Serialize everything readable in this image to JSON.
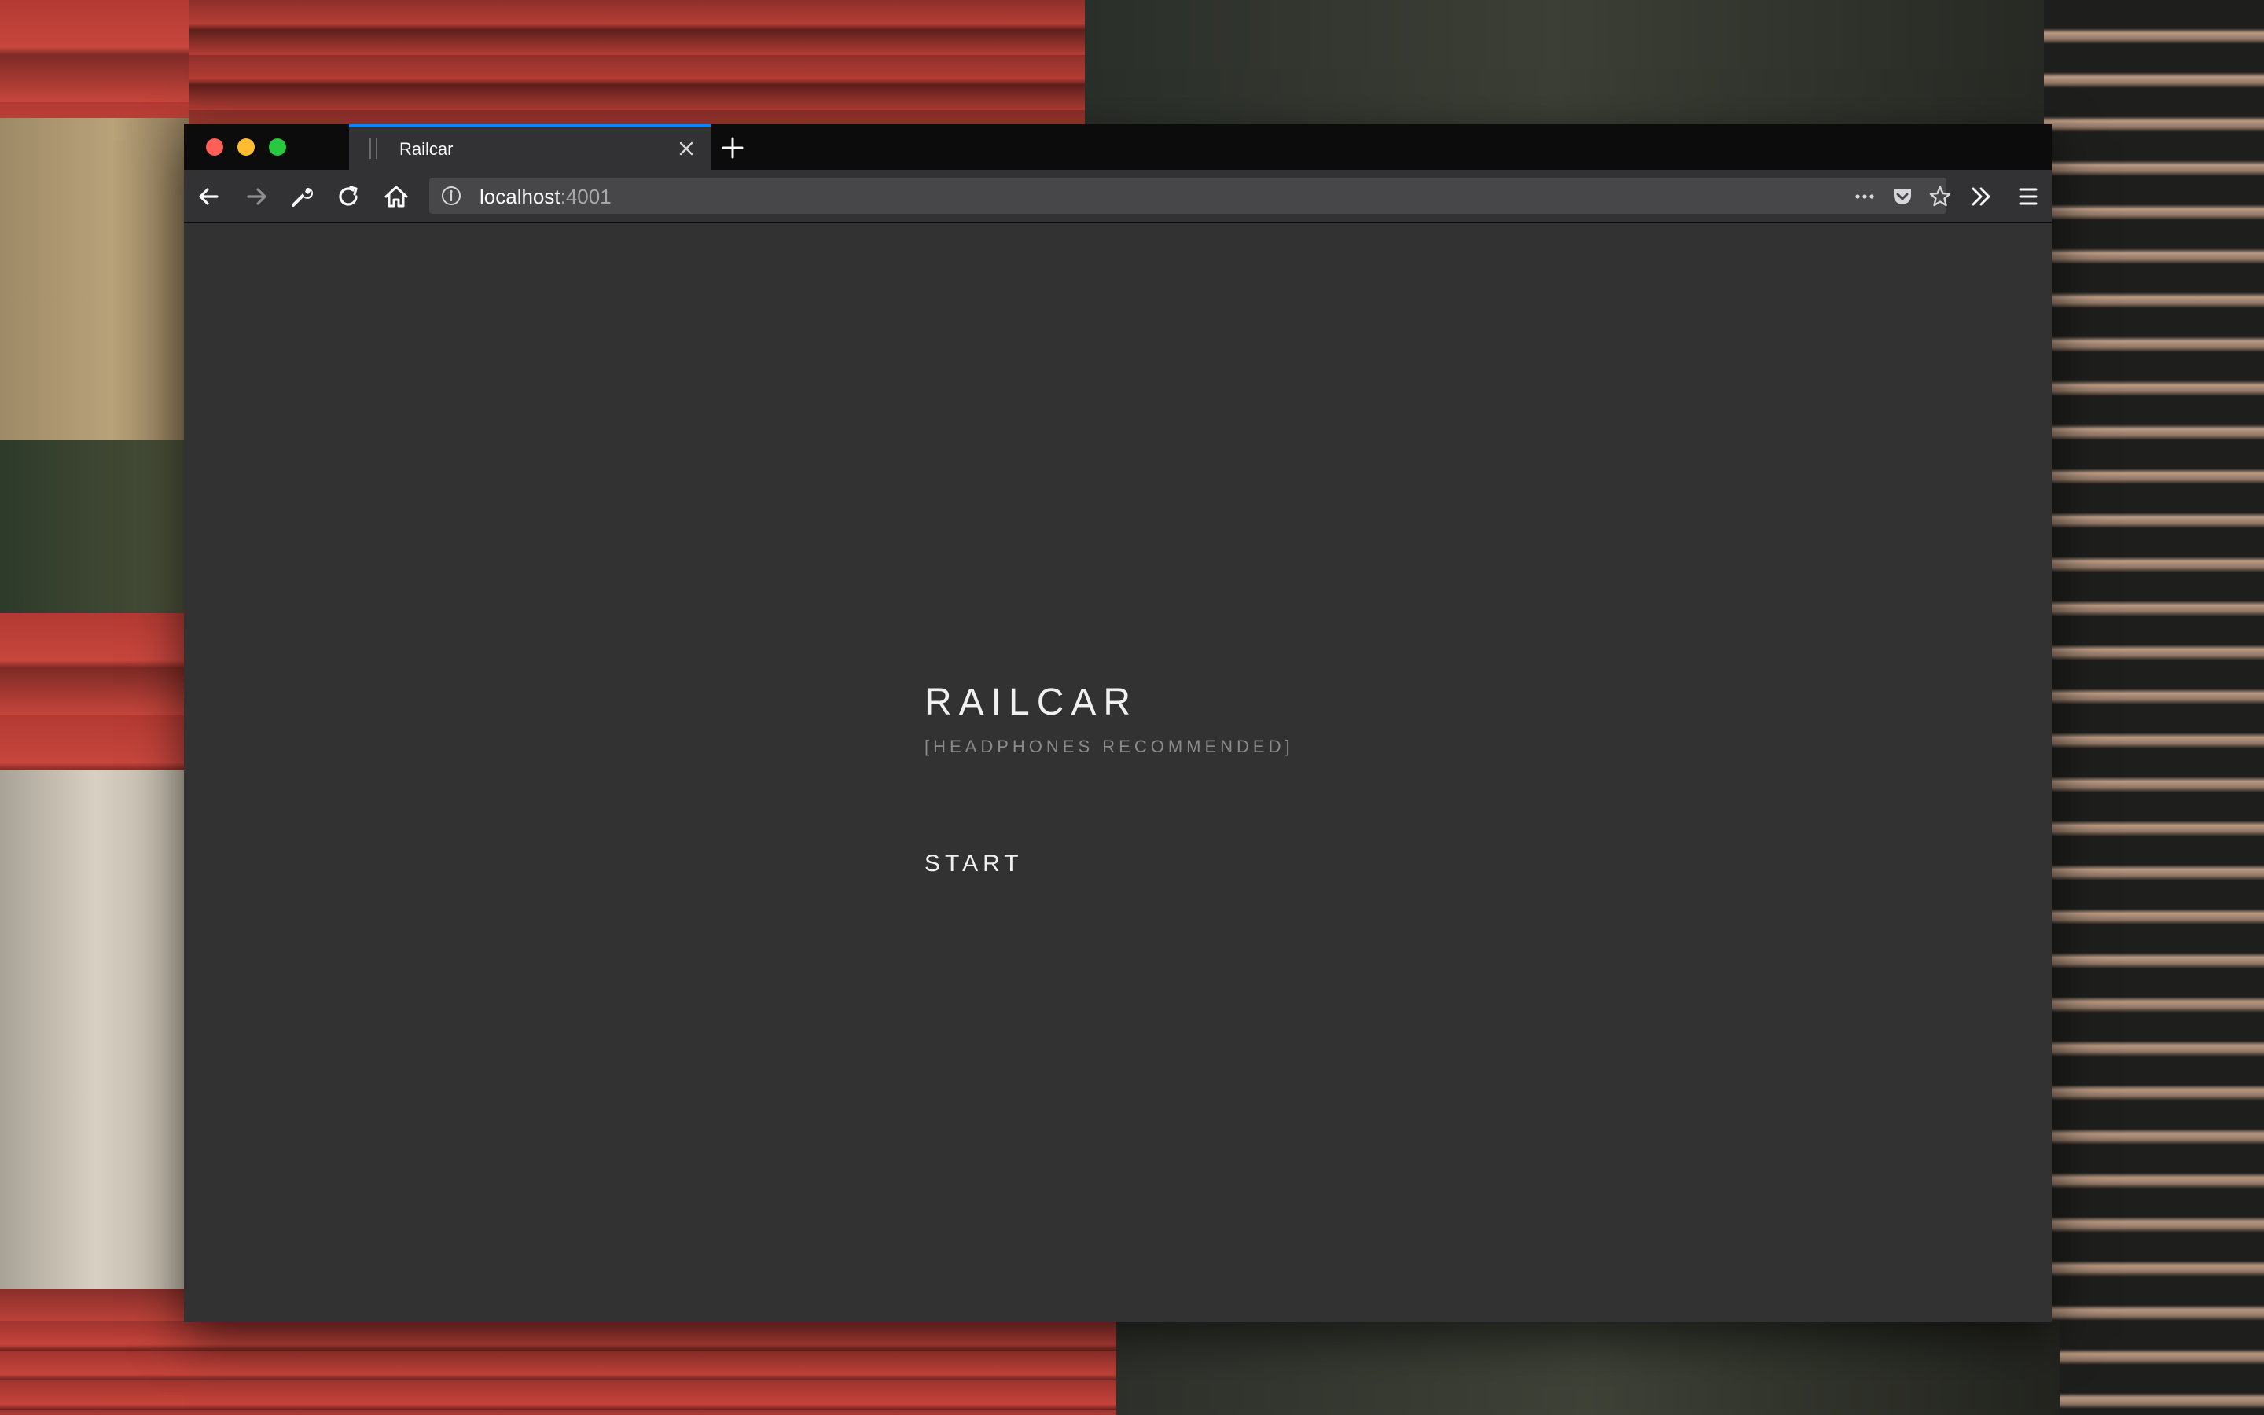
{
  "browser": {
    "tab": {
      "title": "Railcar",
      "close_icon": "close-icon"
    },
    "new_tab_icon": "plus-icon",
    "nav": {
      "back_icon": "arrow-left-icon",
      "forward_icon": "arrow-right-icon",
      "tools_icon": "wrench-icon",
      "reload_icon": "reload-icon",
      "home_icon": "home-icon"
    },
    "url": {
      "host": "localhost",
      "port": ":4001",
      "info_icon": "info-icon"
    },
    "url_actions": [
      "more-icon",
      "pocket-icon",
      "star-icon"
    ],
    "overflow_icon": "chevrons-right-icon",
    "menu_icon": "hamburger-menu-icon",
    "colors": {
      "tab_accent": "#0a84ff",
      "titlebar": "#0c0c0d",
      "toolbar": "#323234",
      "urlbar": "#474749"
    }
  },
  "page": {
    "title": "RAILCAR",
    "subtitle": "[HEADPHONES RECOMMENDED]",
    "start_label": "START",
    "colors": {
      "background": "#323232",
      "title": "#f0f0f0",
      "subtitle": "#8a8a8a"
    }
  }
}
